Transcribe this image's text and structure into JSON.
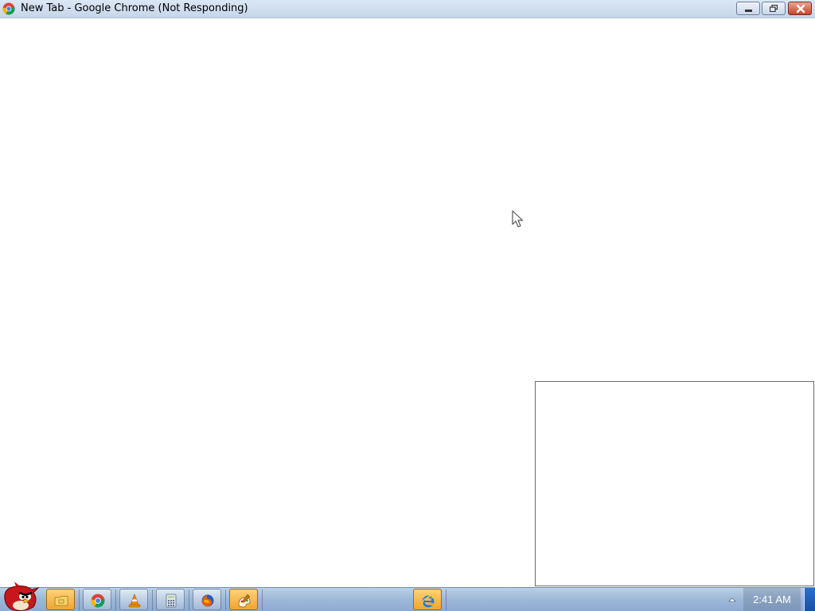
{
  "window": {
    "title": "New Tab - Google Chrome (Not Responding)",
    "icon": "chrome-icon",
    "controls": [
      "minimize-icon",
      "restore-icon",
      "close-icon"
    ]
  },
  "taskbar": {
    "start_icon": "angry-birds-icon",
    "pinned": [
      {
        "name": "windows-explorer",
        "icon": "folder-icon"
      },
      {
        "name": "google-chrome",
        "icon": "chrome-icon"
      },
      {
        "name": "vlc-media-player",
        "icon": "vlc-cone-icon"
      },
      {
        "name": "calculator",
        "icon": "calculator-icon"
      },
      {
        "name": "firefox",
        "icon": "firefox-icon"
      },
      {
        "name": "paint",
        "icon": "paint-icon"
      },
      {
        "name": "internet-explorer",
        "icon": "ie-icon"
      }
    ],
    "clock": "2:41 AM",
    "tray_icon": "show-hidden-icons-arrow"
  },
  "colors": {
    "taskbar": "#9fb9d8",
    "titlebar": "#c6d6ea",
    "close": "#c9442a",
    "active_button": "#f0a52e"
  }
}
